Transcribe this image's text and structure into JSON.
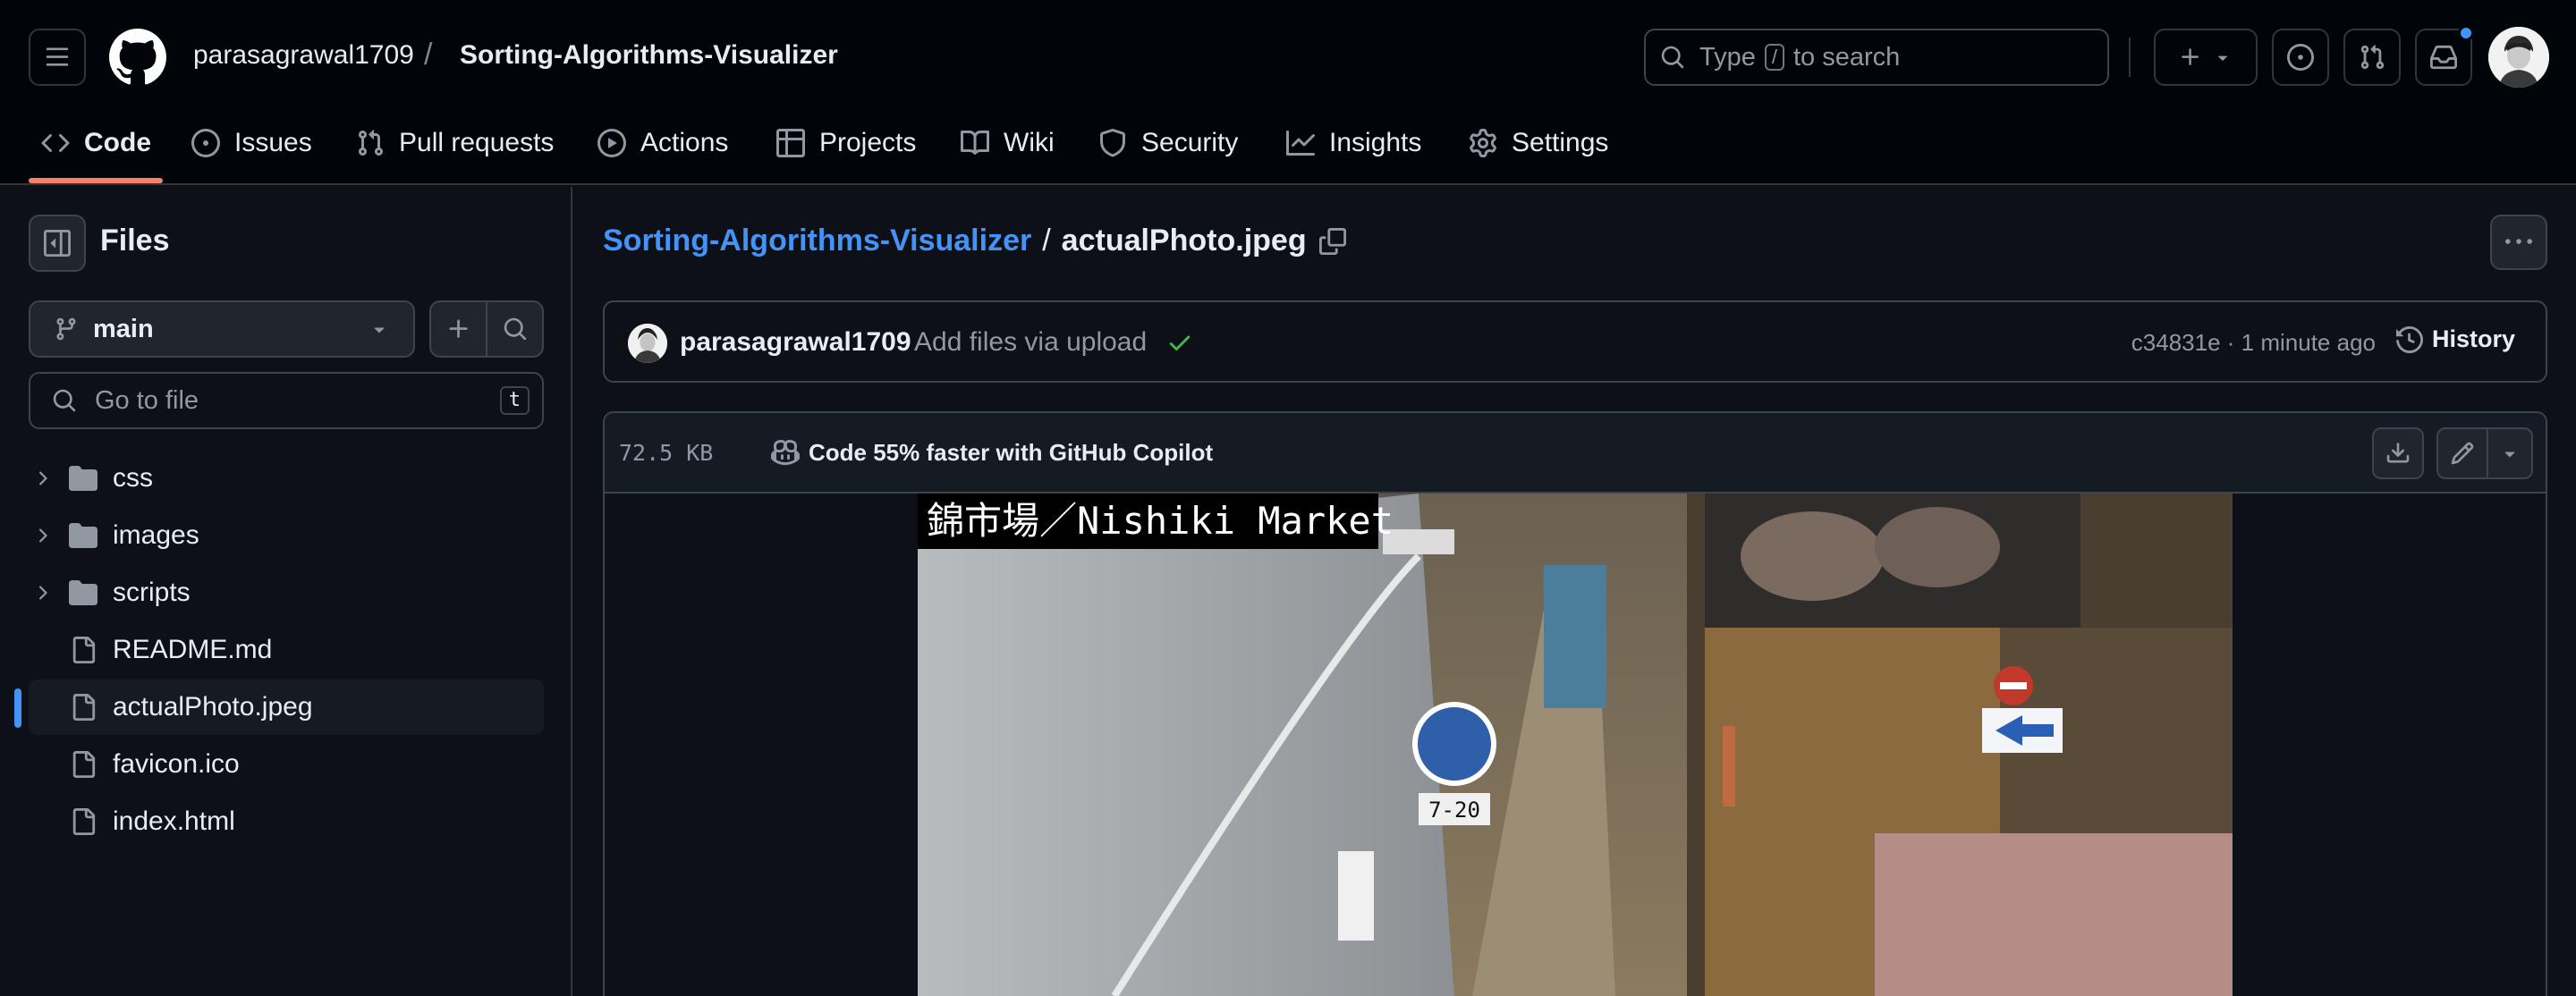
{
  "header": {
    "owner": "parasagrawal1709",
    "separator": "/",
    "repo": "Sorting-Algorithms-Visualizer",
    "search": {
      "prefix": "Type",
      "key": "/",
      "suffix": "to search"
    }
  },
  "nav": {
    "tabs": [
      {
        "label": "Code",
        "icon": "code-icon",
        "active": true
      },
      {
        "label": "Issues",
        "icon": "issue-icon"
      },
      {
        "label": "Pull requests",
        "icon": "pull-request-icon"
      },
      {
        "label": "Actions",
        "icon": "play-icon"
      },
      {
        "label": "Projects",
        "icon": "table-icon"
      },
      {
        "label": "Wiki",
        "icon": "book-icon"
      },
      {
        "label": "Security",
        "icon": "shield-icon"
      },
      {
        "label": "Insights",
        "icon": "graph-icon"
      },
      {
        "label": "Settings",
        "icon": "gear-icon"
      }
    ]
  },
  "sidebar": {
    "title": "Files",
    "branch": "main",
    "goto_placeholder": "Go to file",
    "goto_key": "t",
    "tree": [
      {
        "name": "css",
        "type": "folder"
      },
      {
        "name": "images",
        "type": "folder"
      },
      {
        "name": "scripts",
        "type": "folder"
      },
      {
        "name": "README.md",
        "type": "file"
      },
      {
        "name": "actualPhoto.jpeg",
        "type": "file",
        "active": true
      },
      {
        "name": "favicon.ico",
        "type": "file"
      },
      {
        "name": "index.html",
        "type": "file"
      }
    ]
  },
  "main": {
    "path_repo": "Sorting-Algorithms-Visualizer",
    "path_sep": "/",
    "path_file": "actualPhoto.jpeg",
    "commit": {
      "author": "parasagrawal1709",
      "message": "Add files via upload",
      "meta": "c34831e · 1 minute ago",
      "history_label": "History"
    },
    "file": {
      "size": "72.5 KB",
      "copilot": "Code 55% faster with GitHub Copilot",
      "image_caption": "錦市場／Nishiki Market"
    }
  },
  "colors": {
    "accent_link": "#4493f8",
    "tab_underline": "#f78166",
    "success": "#3fb950",
    "notification": "#4493f8"
  }
}
